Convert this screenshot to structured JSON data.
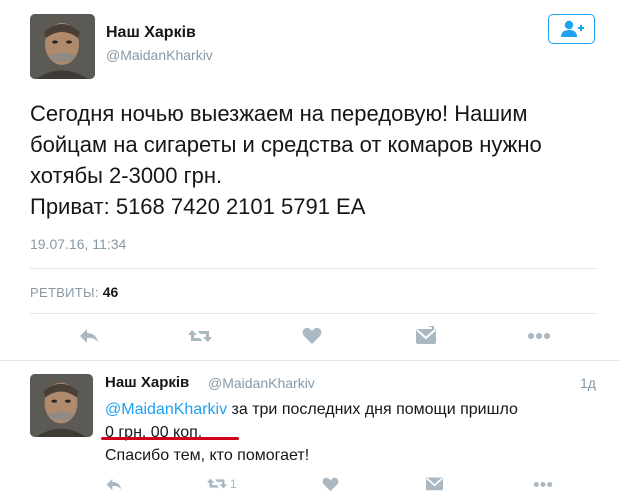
{
  "tweet": {
    "author_name": "Наш Харків",
    "author_handle": "@MaidanKharkiv",
    "text_lines": [
      "Сегодня ночью выезжаем на передовую! Нашим",
      "бойцам на сигареты и средства от комаров нужно",
      "хотябы 2-3000 грн.",
      "Приват: 5168 7420 2101 5791 EA"
    ],
    "timestamp": "19.07.16, 11:34",
    "retweets_label": "РЕТВИТЫ:",
    "retweets_count": "46"
  },
  "reply": {
    "author_name": "Наш Харків",
    "author_handle": "@MaidanKharkiv",
    "time": "1д",
    "mention": "@MaidanKharkiv",
    "line1_rest": " за три последних дня помощи пришло",
    "line2": "0 грн. 00 коп.",
    "line3": "Спасибо тем, кто помогает!",
    "retweet_count": "1"
  },
  "colors": {
    "accent": "#1da1f2",
    "muted": "#8899a6",
    "icon": "#aab8c2",
    "underline": "#d0021b"
  },
  "icons": [
    "follow-user-icon",
    "reply-icon",
    "retweet-icon",
    "like-icon",
    "direct-message-icon",
    "more-icon"
  ]
}
